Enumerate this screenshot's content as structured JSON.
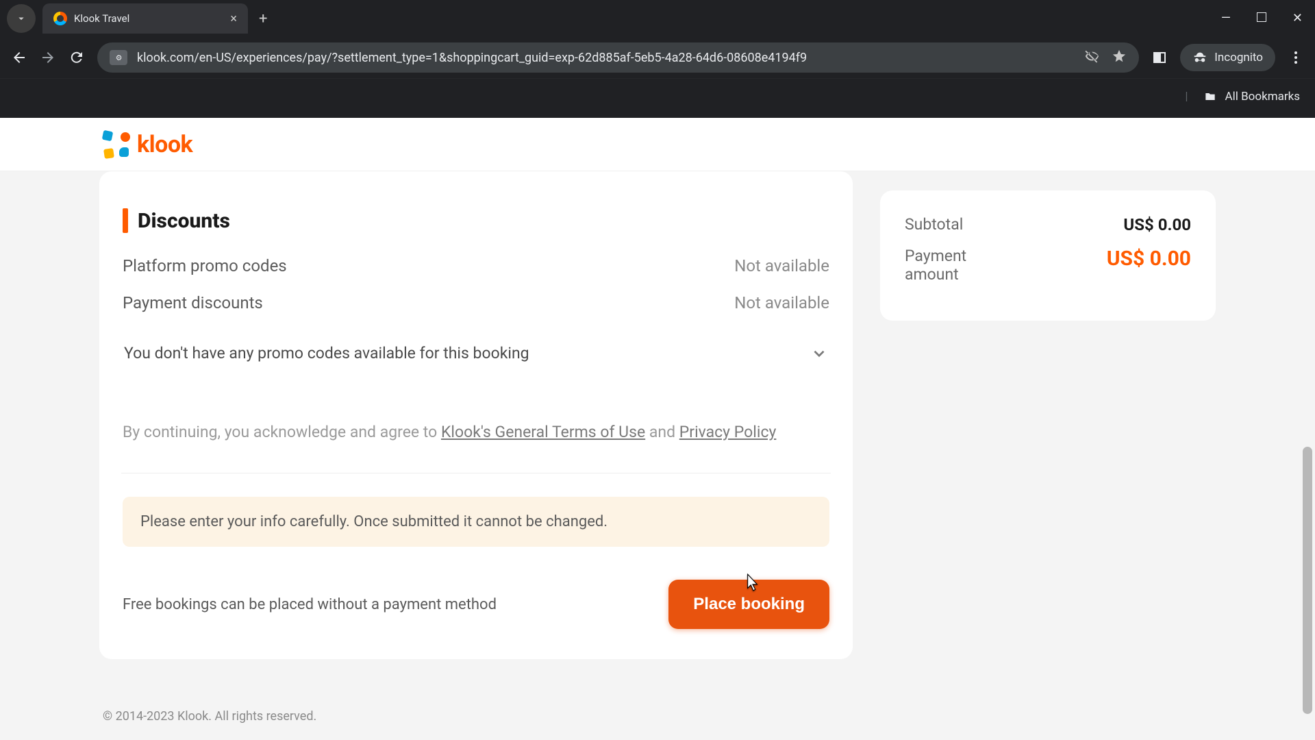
{
  "browser": {
    "tab_title": "Klook Travel",
    "url": "klook.com/en-US/experiences/pay/?settlement_type=1&shoppingcart_guid=exp-62d885af-5eb5-4a28-64d6-08608e4194f9",
    "incognito_label": "Incognito",
    "all_bookmarks": "All Bookmarks"
  },
  "page": {
    "brand": "klook",
    "section_title": "Discounts",
    "platform_promo": {
      "label": "Platform promo codes",
      "status": "Not available"
    },
    "payment_discounts": {
      "label": "Payment discounts",
      "status": "Not available"
    },
    "no_promo_text": "You don't have any promo codes available for this booking",
    "terms_prefix": "By continuing, you acknowledge and agree to ",
    "terms_link": "Klook's General Terms of Use",
    "terms_mid": " and ",
    "privacy_link": "Privacy Policy",
    "warning": "Please enter your info carefully. Once submitted it cannot be changed.",
    "free_note": "Free bookings can be placed without a payment method",
    "place_button": "Place booking",
    "footer": "© 2014-2023 Klook. All rights reserved."
  },
  "summary": {
    "subtotal_label": "Subtotal",
    "subtotal_value": "US$ 0.00",
    "payment_label": "Payment amount",
    "payment_value": "US$ 0.00"
  }
}
